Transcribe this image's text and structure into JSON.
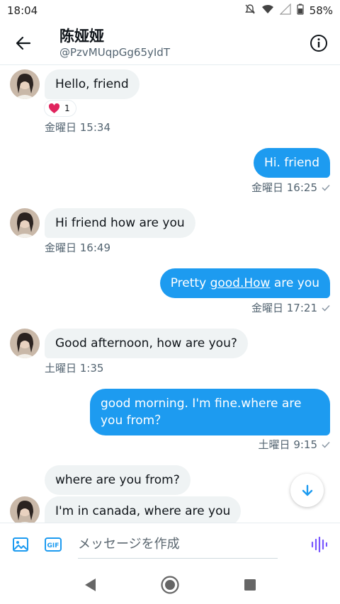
{
  "status_bar": {
    "time": "18:04",
    "battery": "58%"
  },
  "header": {
    "name": "陈娅娅",
    "handle": "@PzvMUqpGg65yIdT"
  },
  "messages": {
    "m1": {
      "text": "Hello, friend",
      "reaction_count": "1",
      "time": "金曜日 15:34"
    },
    "m2": {
      "text": "Hi. friend",
      "time": "金曜日 16:25"
    },
    "m3": {
      "text": "Hi friend how are you",
      "time": "金曜日 16:49"
    },
    "m4": {
      "pre": "Pretty ",
      "link": "good.How",
      "post": " are you",
      "time": "金曜日 17:21"
    },
    "m5": {
      "text": "Good afternoon, how are you?",
      "time": "土曜日 1:35"
    },
    "m6": {
      "line1": "good morning. I'm fine.where are",
      "line2": "you from？",
      "time": "土曜日 9:15"
    },
    "m7": {
      "text": "where are you from?"
    },
    "m8": {
      "text": "I'm in canada, where are you"
    }
  },
  "composer": {
    "placeholder": "メッセージを作成",
    "gif_label": "GIF"
  },
  "colors": {
    "accent": "#1d9bf0",
    "incoming_bubble": "#eff3f4",
    "voice": "#7856ff",
    "heart": "#f91880"
  },
  "icons": [
    "back-arrow-icon",
    "info-icon",
    "heart-icon",
    "read-check-icon",
    "arrow-down-icon",
    "image-icon",
    "gif-icon",
    "voice-icon"
  ]
}
